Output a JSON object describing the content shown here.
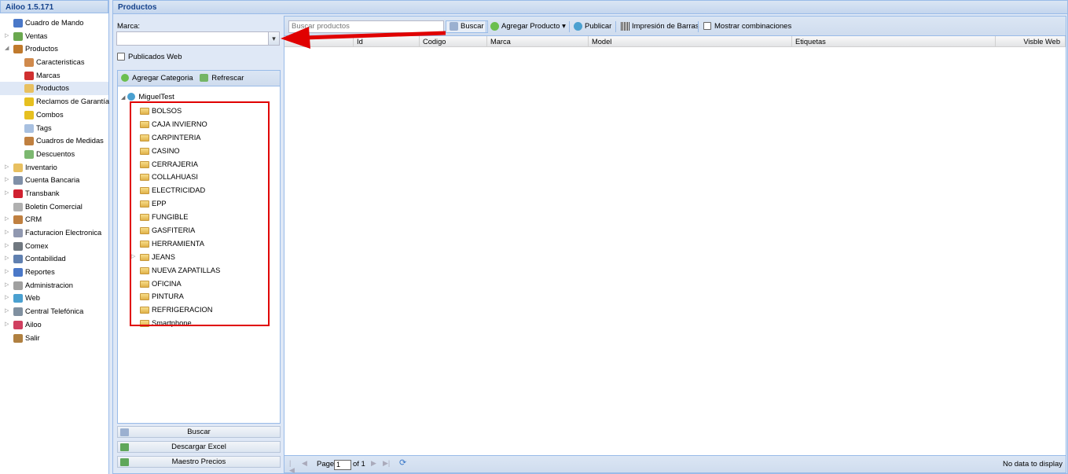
{
  "app": {
    "title": "Ailoo 1.5.171"
  },
  "nav": [
    {
      "label": "Cuadro de Mando",
      "icon": "chart-icon",
      "level": 0,
      "expander": "",
      "color": "#4a78c8"
    },
    {
      "label": "Ventas",
      "icon": "money-icon",
      "level": 0,
      "expander": "▷",
      "color": "#6aa84f"
    },
    {
      "label": "Productos",
      "icon": "box-icon",
      "level": 0,
      "expander": "◢",
      "color": "#c07a2c"
    },
    {
      "label": "Caracteristicas",
      "icon": "grid-icon",
      "level": 1,
      "expander": "",
      "color": "#d08a4c"
    },
    {
      "label": "Marcas",
      "icon": "award-icon",
      "level": 1,
      "expander": "",
      "color": "#d03030"
    },
    {
      "label": "Productos",
      "icon": "package-icon",
      "level": 1,
      "expander": "",
      "color": "#e8c060",
      "selected": true
    },
    {
      "label": "Reclamos de Garantía",
      "icon": "folder-icon",
      "level": 1,
      "expander": "",
      "color": "#e6c020"
    },
    {
      "label": "Combos",
      "icon": "folder-icon",
      "level": 1,
      "expander": "",
      "color": "#e6c020"
    },
    {
      "label": "Tags",
      "icon": "tag-icon",
      "level": 1,
      "expander": "",
      "color": "#a8c0e0"
    },
    {
      "label": "Cuadros de Medidas",
      "icon": "ruler-icon",
      "level": 1,
      "expander": "",
      "color": "#c08040"
    },
    {
      "label": "Descuentos",
      "icon": "discount-icon",
      "level": 1,
      "expander": "",
      "color": "#7cb870"
    },
    {
      "label": "Inventario",
      "icon": "box-icon",
      "level": 0,
      "expander": "▷",
      "color": "#e8c060"
    },
    {
      "label": "Cuenta Bancaria",
      "icon": "bank-icon",
      "level": 0,
      "expander": "▷",
      "color": "#8090a8"
    },
    {
      "label": "Transbank",
      "icon": "transbank-icon",
      "level": 0,
      "expander": "▷",
      "color": "#d02030"
    },
    {
      "label": "Boletin Comercial",
      "icon": "newsletter-icon",
      "level": 0,
      "expander": "",
      "color": "#b0b0b0"
    },
    {
      "label": "CRM",
      "icon": "users-icon",
      "level": 0,
      "expander": "▷",
      "color": "#c08040"
    },
    {
      "label": "Facturacion Electronica",
      "icon": "invoice-icon",
      "level": 0,
      "expander": "▷",
      "color": "#9098b0"
    },
    {
      "label": "Comex",
      "icon": "truck-icon",
      "level": 0,
      "expander": "▷",
      "color": "#707880"
    },
    {
      "label": "Contabilidad",
      "icon": "ledger-icon",
      "level": 0,
      "expander": "▷",
      "color": "#6080b0"
    },
    {
      "label": "Reportes",
      "icon": "chart-icon",
      "level": 0,
      "expander": "▷",
      "color": "#4a78c8"
    },
    {
      "label": "Administracion",
      "icon": "gear-icon",
      "level": 0,
      "expander": "▷",
      "color": "#a0a0a0"
    },
    {
      "label": "Web",
      "icon": "globe-icon",
      "level": 0,
      "expander": "▷",
      "color": "#4aa0d0"
    },
    {
      "label": "Central Telefónica",
      "icon": "phone-icon",
      "level": 0,
      "expander": "▷",
      "color": "#8090a0"
    },
    {
      "label": "Ailoo",
      "icon": "ailoo-icon",
      "level": 0,
      "expander": "▷",
      "color": "#d04060"
    },
    {
      "label": "Salir",
      "icon": "exit-icon",
      "level": 0,
      "expander": "",
      "color": "#b08040"
    }
  ],
  "productos": {
    "panel_title": "Productos",
    "marca_label": "Marca:",
    "marca_value": "",
    "publicados_label": "Publicados Web",
    "tree_toolbar": {
      "add": "Agregar Categoria",
      "refresh": "Refrescar"
    },
    "tree_root": "MiguelTest",
    "categories": [
      {
        "label": "BOLSOS",
        "expandable": false
      },
      {
        "label": "CAJA INVIERNO",
        "expandable": false
      },
      {
        "label": "CARPINTERIA",
        "expandable": false
      },
      {
        "label": "CASINO",
        "expandable": false
      },
      {
        "label": "CERRAJERIA",
        "expandable": false
      },
      {
        "label": "COLLAHUASI",
        "expandable": false
      },
      {
        "label": "ELECTRICIDAD",
        "expandable": false
      },
      {
        "label": "EPP",
        "expandable": false
      },
      {
        "label": "FUNGIBLE",
        "expandable": false
      },
      {
        "label": "GASFITERIA",
        "expandable": false
      },
      {
        "label": "HERRAMIENTA",
        "expandable": false
      },
      {
        "label": "JEANS",
        "expandable": true
      },
      {
        "label": "NUEVA ZAPATILLAS",
        "expandable": false
      },
      {
        "label": "OFICINA",
        "expandable": false
      },
      {
        "label": "PINTURA",
        "expandable": false
      },
      {
        "label": "REFRIGERACION",
        "expandable": false
      },
      {
        "label": "Smartphone",
        "expandable": false
      }
    ],
    "buttons": {
      "buscar": "Buscar",
      "excel": "Descargar Excel",
      "precios": "Maestro Precios"
    }
  },
  "grid": {
    "search_placeholder": "Buscar productos",
    "toolbar": {
      "buscar": "Buscar",
      "agregar": "Agregar Producto",
      "publicar": "Publicar",
      "barras": "Impresión de Barras",
      "combinaciones": "Mostrar combinaciones"
    },
    "columns": [
      "",
      "Id",
      "Codigo",
      "Marca",
      "Model",
      "Etiquetas",
      "Visble Web"
    ],
    "pager": {
      "page_label": "Page",
      "page_value": "1",
      "of_label": "of 1",
      "status": "No data to display"
    }
  }
}
